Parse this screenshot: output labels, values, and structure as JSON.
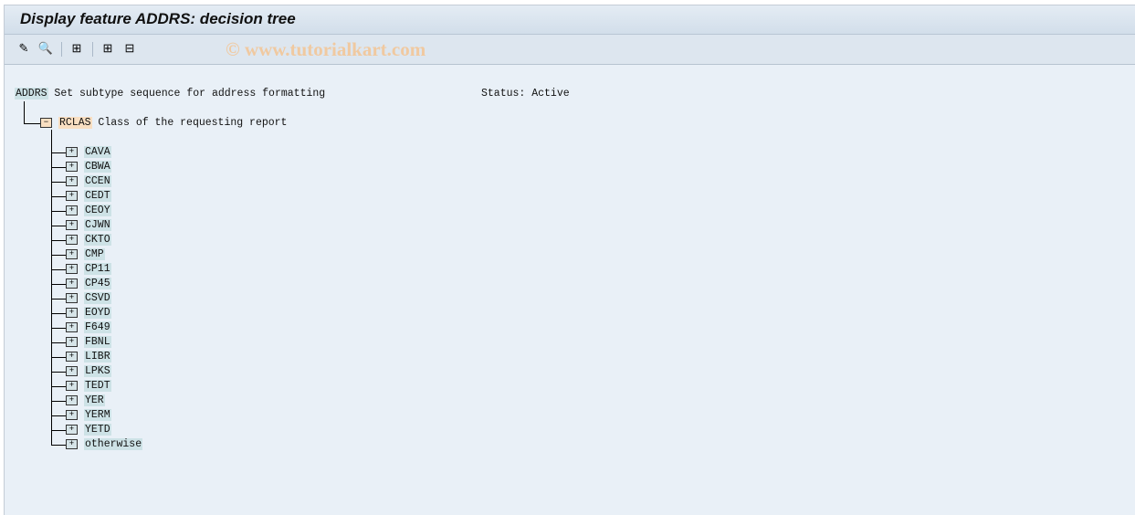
{
  "title": "Display feature ADDRS: decision tree",
  "watermark": "© www.tutorialkart.com",
  "toolbar": [
    {
      "icon": "pencil-glasses-icon",
      "name": "change-display-button",
      "glyph": "✎"
    },
    {
      "icon": "magnifier-icon",
      "name": "find-button",
      "glyph": "🔍"
    },
    {
      "icon": "hierarchy-icon",
      "name": "structure-button",
      "glyph": "⊞"
    },
    {
      "icon": "expand-icon",
      "name": "expand-all-button",
      "glyph": "⊞"
    },
    {
      "icon": "collapse-icon",
      "name": "collapse-all-button",
      "glyph": "⊟"
    }
  ],
  "root": {
    "key": "ADDRS",
    "text": "Set subtype sequence for address formatting",
    "status": "Status: Active"
  },
  "level1": {
    "key": "RCLAS",
    "text": "Class of the requesting report"
  },
  "children": [
    "CAVA",
    "CBWA",
    "CCEN",
    "CEDT",
    "CEOY",
    "CJWN",
    "CKTO",
    "CMP",
    "CP11",
    "CP45",
    "CSVD",
    "EOYD",
    "F649",
    "FBNL",
    "LIBR",
    "LPKS",
    "TEDT",
    "YER",
    "YERM",
    "YETD",
    "otherwise"
  ]
}
